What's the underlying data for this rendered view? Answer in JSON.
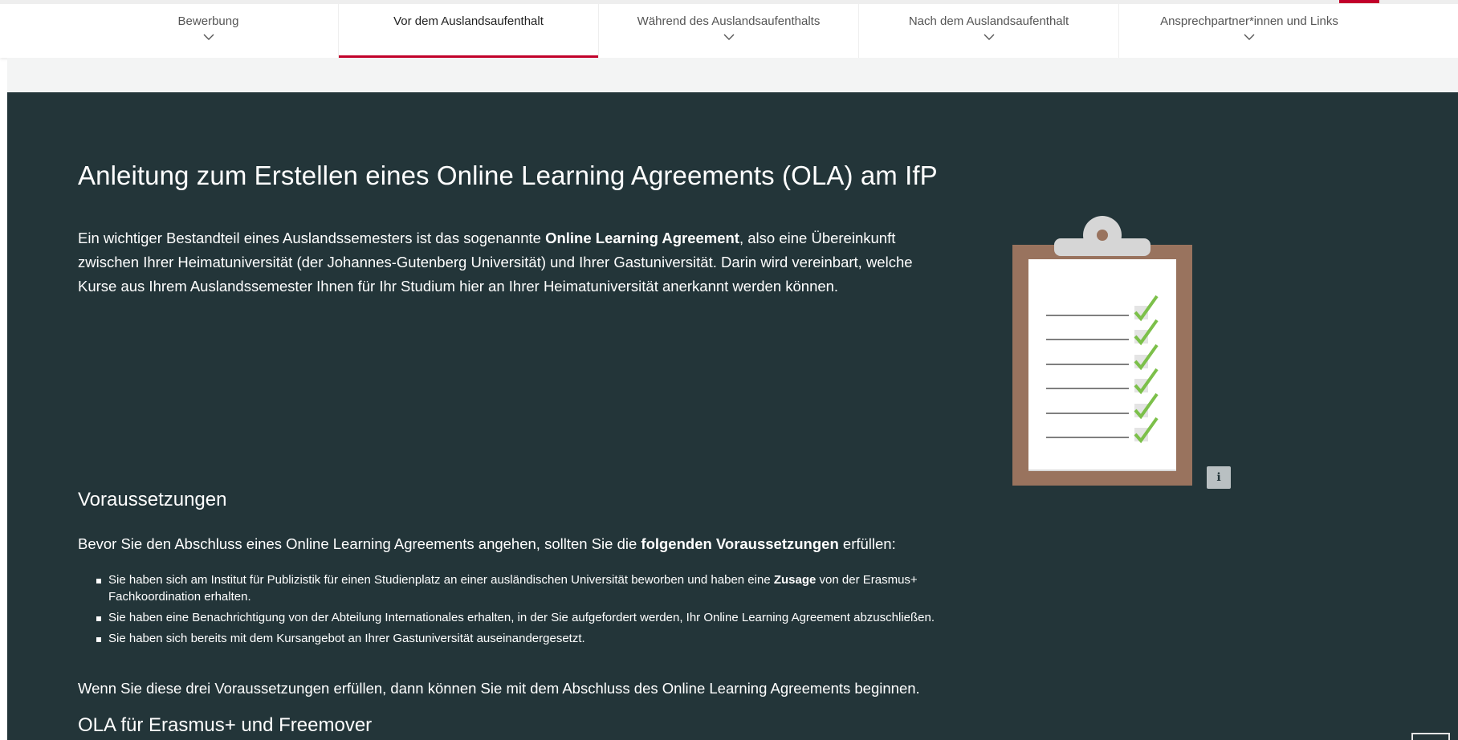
{
  "nav": {
    "tabs": [
      {
        "label": "Bewerbung",
        "has_dropdown": true,
        "active": false
      },
      {
        "label": "Vor dem Auslandsaufenthalt",
        "has_dropdown": false,
        "active": true
      },
      {
        "label": "Während des Auslandsaufenthalts",
        "has_dropdown": true,
        "active": false
      },
      {
        "label": "Nach dem Auslandsaufenthalt",
        "has_dropdown": true,
        "active": false
      },
      {
        "label": "Ansprechpartner*innen und Links",
        "has_dropdown": true,
        "active": false
      }
    ],
    "active_color": "#c1002a"
  },
  "main": {
    "title": "Anleitung zum Erstellen eines Online Learning Agreements (OLA) am IfP",
    "intro": {
      "part1": "Ein wichtiger Bestandteil eines Auslandssemesters ist das sogenannte ",
      "bold": "Online Learning Agreement",
      "part2": ", also eine Übereinkunft zwischen Ihrer Heimatuniversität (der Johannes-Gutenberg Universität) und Ihrer Gastuniversität. Darin wird vereinbart, welche Kurse aus Ihrem Auslandssemester Ihnen für Ihr Studium hier an Ihrer Heimatuniversität anerkannt werden können."
    },
    "requirements_heading": "Voraussetzungen",
    "requirements_lead": {
      "part1": "Bevor Sie den Abschluss eines Online Learning Agreements angehen, sollten Sie die ",
      "bold": "folgenden Voraussetzungen",
      "part2": " erfüllen:"
    },
    "requirements": [
      {
        "part1": "Sie haben sich am Institut für Publizistik für einen Studienplatz an einer ausländischen Universität beworben und haben eine ",
        "bold": "Zusage",
        "part2": " von der Erasmus+ Fachkoordination erhalten."
      },
      {
        "part1": "Sie haben eine Benachrichtigung von der Abteilung Internationales erhalten, in der Sie aufgefordert werden, Ihr Online Learning Agreement abzuschließen.",
        "bold": "",
        "part2": ""
      },
      {
        "part1": "Sie haben sich bereits mit dem Kursangebot an Ihrer Gastuniversität auseinandergesetzt.",
        "bold": "",
        "part2": ""
      }
    ],
    "closing": "Wenn Sie diese drei Voraussetzungen erfüllen, dann können Sie mit dem Abschluss des Online Learning Agreements beginnen.",
    "ola_heading": "OLA für Erasmus+ und Freemover",
    "image": {
      "icon": "clipboard-checklist-illustration",
      "checklist_rows": 6,
      "info_icon": "info-icon",
      "info_glyph": "ℹ"
    },
    "colors": {
      "content_bg": "#233539",
      "strip_bg": "#f3f4f4",
      "text": "#ffffff"
    }
  }
}
